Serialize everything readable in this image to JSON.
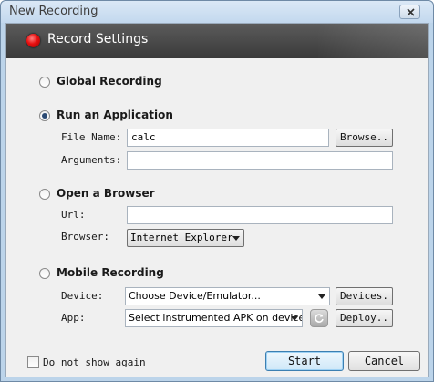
{
  "window": {
    "title": "New Recording"
  },
  "header": {
    "title": "Record Settings"
  },
  "global_recording": {
    "label": "Global Recording",
    "selected": false
  },
  "run_application": {
    "label": "Run an Application",
    "selected": true,
    "file_name_label": "File Name:",
    "file_name_value": "calc",
    "browse_label": "Browse..",
    "arguments_label": "Arguments:",
    "arguments_value": ""
  },
  "open_browser": {
    "label": "Open a Browser",
    "selected": false,
    "url_label": "Url:",
    "url_value": "",
    "browser_label": "Browser:",
    "browser_value": "Internet Explorer"
  },
  "mobile_recording": {
    "label": "Mobile Recording",
    "selected": false,
    "device_label": "Device:",
    "device_value": "Choose Device/Emulator...",
    "devices_button": "Devices.",
    "app_label": "App:",
    "app_value": "Select instrumented APK on device...",
    "deploy_button": "Deploy.."
  },
  "footer": {
    "dont_show_label": "Do not show again",
    "dont_show_checked": false,
    "start_label": "Start",
    "cancel_label": "Cancel"
  },
  "icons": {
    "close": "close-icon",
    "record": "record-dot-icon",
    "refresh": "refresh-icon",
    "dropdown": "chevron-down-icon"
  },
  "colors": {
    "header_bg": "#3f3f3f",
    "record_dot": "#e81010",
    "window_frame": "#bcd4ea"
  }
}
